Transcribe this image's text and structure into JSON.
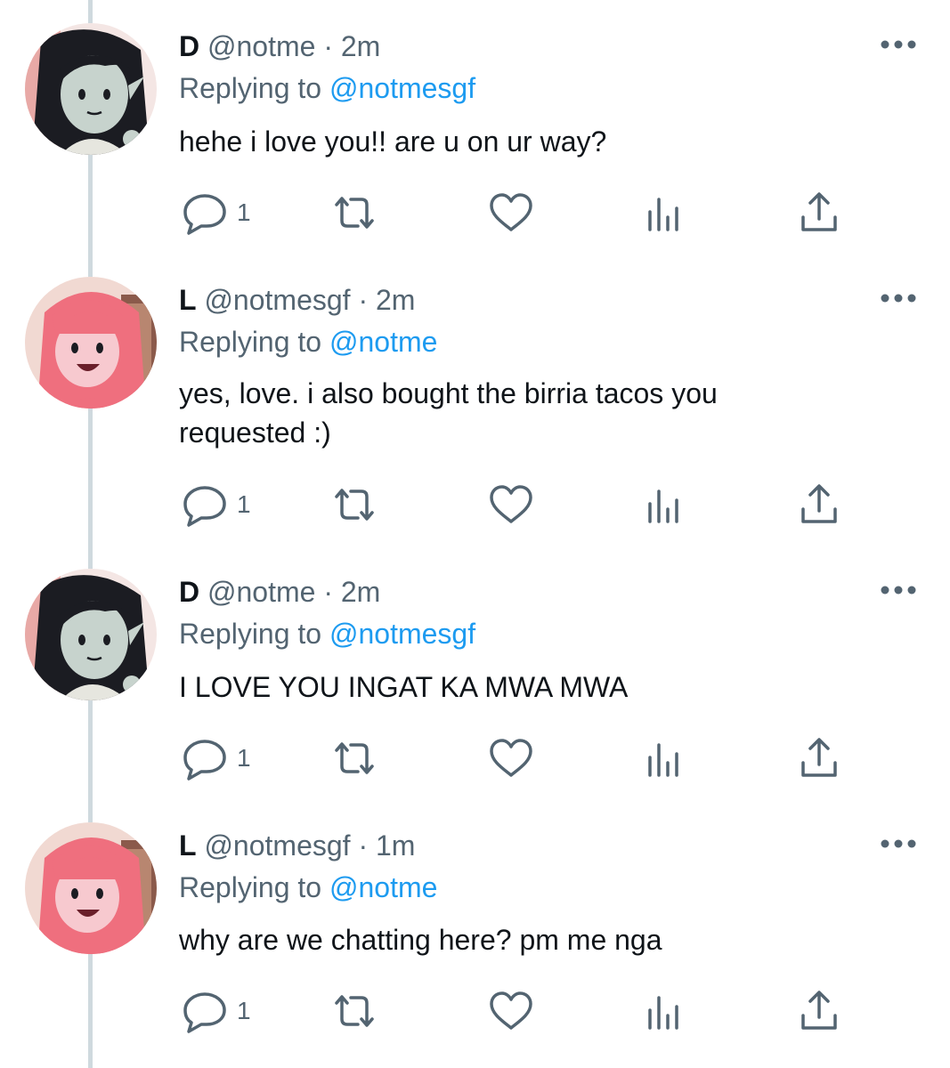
{
  "theme": {
    "accent": "#1d9bf0",
    "text": "#0f1419",
    "muted": "#536471",
    "thread_line": "#cfd9de"
  },
  "tweets": [
    {
      "name": "D",
      "handle": "@notme",
      "separator": "·",
      "time": "2m",
      "replying_label": "Replying to",
      "replying_to": "@notmesgf",
      "text": "hehe i love you!! are u on ur way?",
      "reply_count": "1",
      "avatar": "dark-hair-avatar"
    },
    {
      "name": "L",
      "handle": "@notmesgf",
      "separator": "·",
      "time": "2m",
      "replying_label": "Replying to",
      "replying_to": "@notme",
      "text": "yes, love. i also bought the birria tacos you requested :)",
      "reply_count": "1",
      "avatar": "pink-hair-avatar"
    },
    {
      "name": "D",
      "handle": "@notme",
      "separator": "·",
      "time": "2m",
      "replying_label": "Replying to",
      "replying_to": "@notmesgf",
      "text": "I LOVE YOU INGAT KA MWA MWA",
      "reply_count": "1",
      "avatar": "dark-hair-avatar"
    },
    {
      "name": "L",
      "handle": "@notmesgf",
      "separator": "·",
      "time": "1m",
      "replying_label": "Replying to",
      "replying_to": "@notme",
      "text": "why are we chatting here? pm me nga",
      "reply_count": "1",
      "avatar": "pink-hair-avatar"
    }
  ],
  "icons": {
    "reply": "reply-icon",
    "retweet": "retweet-icon",
    "like": "heart-icon",
    "views": "views-icon",
    "share": "share-icon",
    "more": "more-icon"
  }
}
